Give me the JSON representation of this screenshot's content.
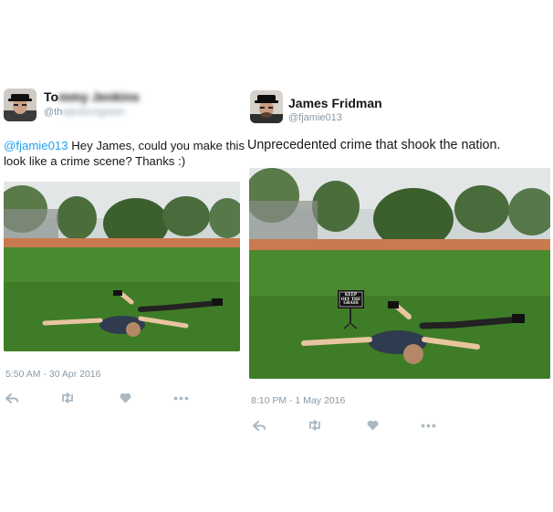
{
  "left_tweet": {
    "name": "To",
    "name_obscured": "mmy Jenkins",
    "handle": "@th",
    "handle_obscured": "ejenkinsgreen",
    "text_mention": "@fjamie013",
    "text_body": " Hey James, could you make this look like a crime scene? Thanks :)",
    "timestamp": "5:50 AM - 30 Apr 2016"
  },
  "right_tweet": {
    "name": "James Fridman",
    "handle": "@fjamie013",
    "text": "Unprecedented crime that shook the nation.",
    "timestamp": "8:10 PM - 1 May 2016",
    "sign_text": "KEEP OFF THE GRASS"
  },
  "icons": {
    "reply": "reply-icon",
    "retweet": "retweet-icon",
    "like": "heart-icon",
    "more": "more-icon"
  },
  "colors": {
    "accent": "#1da1f2",
    "muted": "#8899a6",
    "icon": "#aab8c2"
  }
}
